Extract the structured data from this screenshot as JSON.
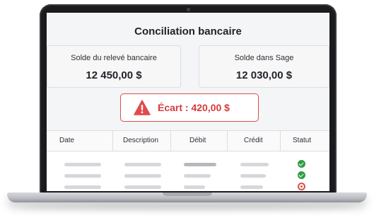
{
  "app": {
    "title": "Conciliation bancaire"
  },
  "cards": {
    "statement": {
      "label": "Solde du relevé bancaire",
      "value": "12 450,00 $"
    },
    "sage": {
      "label": "Solde dans Sage",
      "value": "12 030,00 $"
    }
  },
  "alert": {
    "text": "Écart : 420,00 $",
    "icon": "warning-triangle-icon",
    "color": "#e14b4b"
  },
  "table": {
    "columns": [
      "Date",
      "Description",
      "Débit",
      "Crédit",
      "Statut"
    ],
    "rows": [
      {
        "status": "ok",
        "status_icon": "check-circle-icon"
      },
      {
        "status": "ok",
        "status_icon": "check-circle-icon"
      },
      {
        "status": "error",
        "status_icon": "error-circle-icon"
      }
    ]
  },
  "colors": {
    "success": "#2f9e44",
    "error": "#e14b4b"
  }
}
